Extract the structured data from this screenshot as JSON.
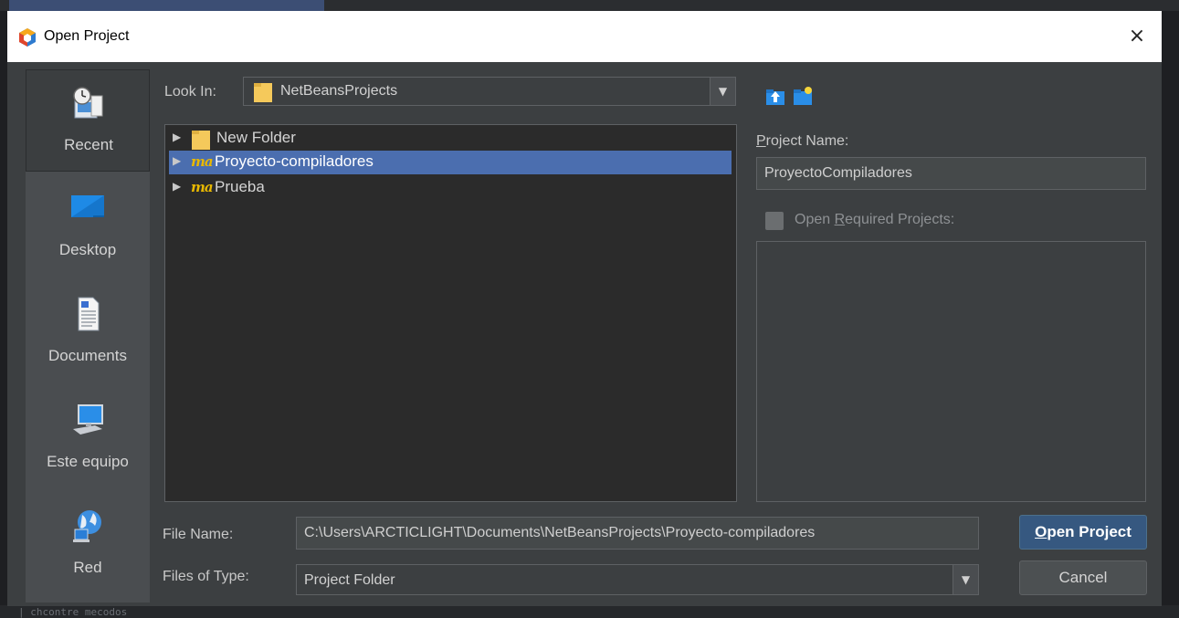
{
  "dialog": {
    "title": "Open Project",
    "close_glyph": "×"
  },
  "sidebar": {
    "items": [
      {
        "label": "Recent",
        "icon": "recent-icon"
      },
      {
        "label": "Desktop",
        "icon": "desktop-icon"
      },
      {
        "label": "Documents",
        "icon": "documents-icon"
      },
      {
        "label": "Este equipo",
        "icon": "computer-icon"
      },
      {
        "label": "Red",
        "icon": "network-icon"
      }
    ]
  },
  "lookin": {
    "label": "Look In:",
    "value": "NetBeansProjects"
  },
  "toolbar": {
    "up_icon": "up-folder-icon",
    "new_icon": "new-folder-icon"
  },
  "tree": {
    "items": [
      {
        "label": "New Folder",
        "icon": "folder-icon"
      },
      {
        "label": "Proyecto-compiladores",
        "icon": "maven-project-icon",
        "selected": true
      },
      {
        "label": "Prueba",
        "icon": "maven-project-icon"
      }
    ],
    "maven_mark": "ma"
  },
  "project": {
    "name_label": "Project Name:",
    "name_mnemonic": "P",
    "name_rest": "roject Name:",
    "name_value": "ProyectoCompiladores",
    "required_pre": "Open ",
    "required_mnemonic": "R",
    "required_post": "equired Projects:"
  },
  "filename": {
    "label": "File Name:",
    "value": "C:\\Users\\ARCTICLIGHT\\Documents\\NetBeansProjects\\Proyecto-compiladores"
  },
  "filetype": {
    "label": "Files of Type:",
    "value": "Project Folder"
  },
  "buttons": {
    "open_mnemonic": "O",
    "open_rest": "pen Project",
    "cancel": "Cancel"
  },
  "background": {
    "bottom_text": "| chcontre mecodos"
  },
  "colors": {
    "selection": "#4b6eaf",
    "primary_button": "#365880",
    "dialog_bg": "#3c3f41"
  }
}
